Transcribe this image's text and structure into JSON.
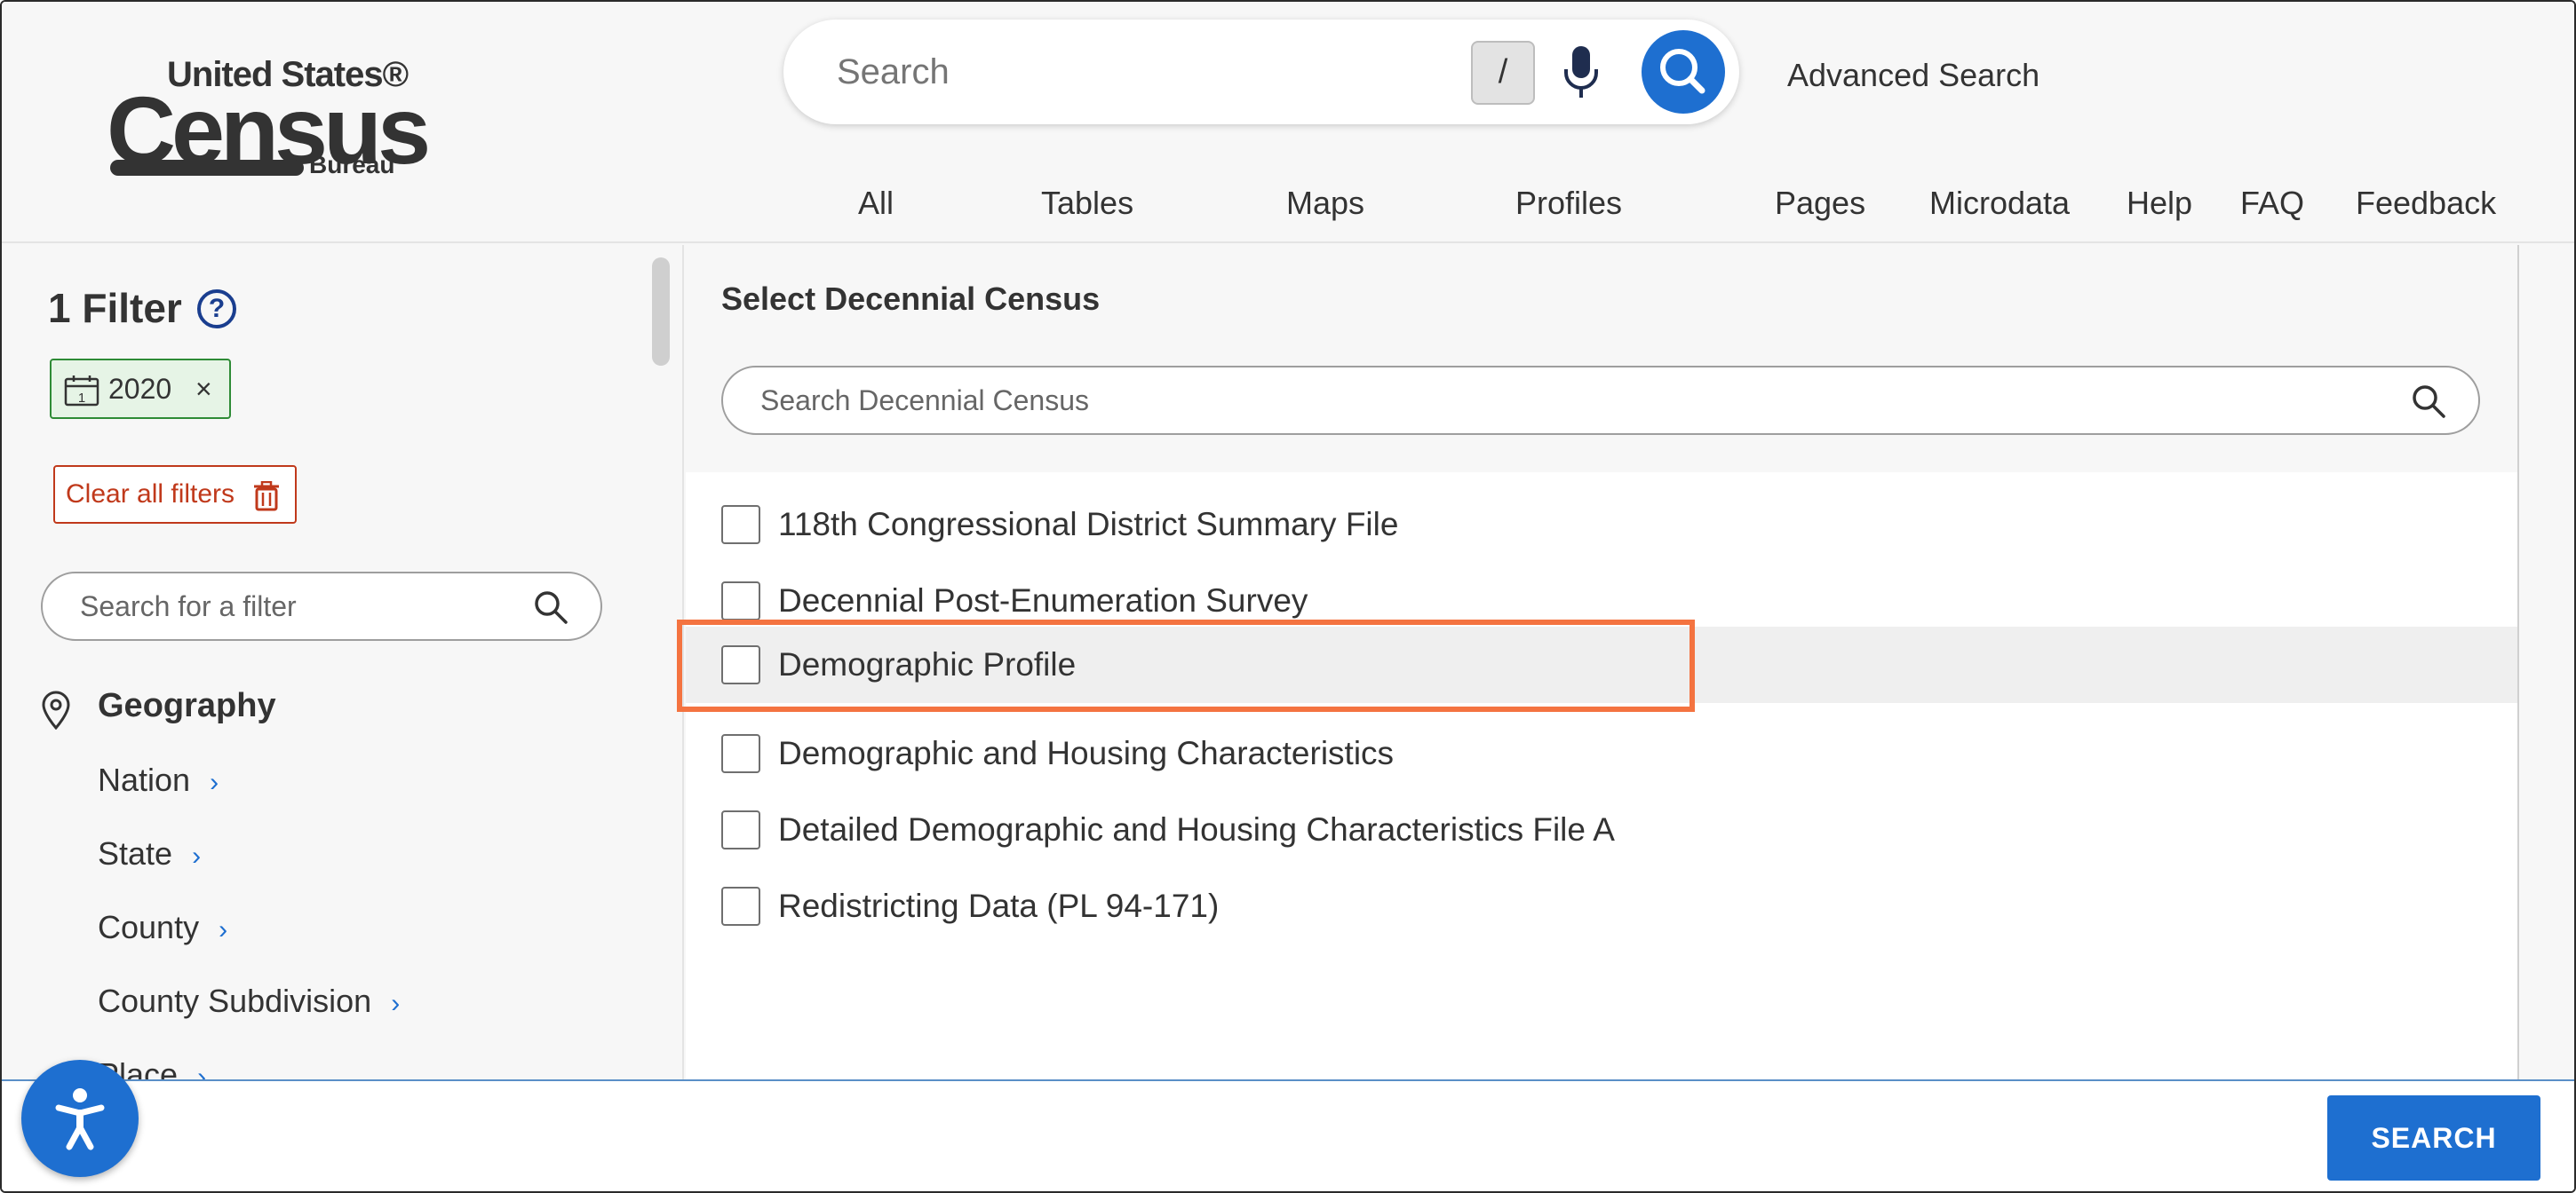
{
  "logo": {
    "line1": "United States®",
    "line2": "Census",
    "line3": "Bureau"
  },
  "search": {
    "placeholder": "Search",
    "shortcut_key": "/",
    "advanced_label": "Advanced Search"
  },
  "nav_tabs": [
    "All",
    "Tables",
    "Maps",
    "Profiles",
    "Pages",
    "Microdata",
    "Help",
    "FAQ",
    "Feedback"
  ],
  "sidebar": {
    "filter_count_label": "1 Filter",
    "help_glyph": "?",
    "active_chip": {
      "label": "2020",
      "remove_glyph": "×"
    },
    "clear_all_label": "Clear all filters",
    "filter_search_placeholder": "Search for a filter",
    "geography_label": "Geography",
    "geography_items": [
      "Nation",
      "State",
      "County",
      "County Subdivision",
      "Place"
    ],
    "chevron_glyph": "›"
  },
  "main": {
    "title": "Select Decennial Census",
    "search_placeholder": "Search Decennial Census",
    "options": [
      {
        "label": "118th Congressional District Summary File",
        "checked": false,
        "highlighted": false
      },
      {
        "label": "Decennial Post-Enumeration Survey",
        "checked": false,
        "highlighted": false
      },
      {
        "label": "Demographic Profile",
        "checked": false,
        "highlighted": true
      },
      {
        "label": "Demographic and Housing Characteristics",
        "checked": false,
        "highlighted": false
      },
      {
        "label": "Detailed Demographic and Housing Characteristics File A",
        "checked": false,
        "highlighted": false
      },
      {
        "label": "Redistricting Data (PL 94-171)",
        "checked": false,
        "highlighted": false
      }
    ]
  },
  "footer": {
    "search_button_label": "SEARCH"
  },
  "colors": {
    "accent": "#1e6fd0",
    "highlight_outline": "#f47340",
    "chip_green": "#2e8b36",
    "clear_red": "#c0391b"
  }
}
